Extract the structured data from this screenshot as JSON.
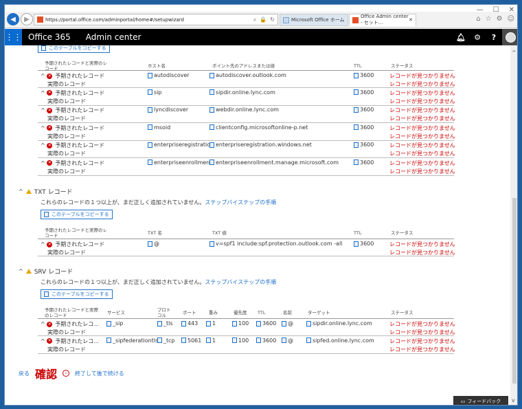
{
  "browser": {
    "url": "https://portal.office.com/adminportal/home#/setupwizard",
    "tabs": [
      {
        "label": "Microsoft Office ホーム"
      },
      {
        "label": "Office Admin center - セット..."
      }
    ]
  },
  "appbar": {
    "brand": "Office 365",
    "title": "Admin center",
    "icons": [
      "bell-icon",
      "gear-icon",
      "help-icon"
    ]
  },
  "copy_label": "このテーブルをコピーする",
  "expected_label": "予期されたレコード",
  "actual_label": "実際のレコード",
  "status_missing": "レコードが見つかりません",
  "cname": {
    "headers": {
      "record": "予期されたレコードと実際のレコード",
      "host": "ホスト名",
      "points": "ポイント先のアドレスまたは値",
      "ttl": "TTL",
      "status": "ステータス"
    },
    "rows": [
      {
        "host": "autodiscover",
        "value": "autodiscover.outlook.com",
        "ttl": "3600"
      },
      {
        "host": "sip",
        "value": "sipdir.online.lync.com",
        "ttl": "3600"
      },
      {
        "host": "lyncdiscover",
        "value": "webdir.online.lync.com",
        "ttl": "3600"
      },
      {
        "host": "msoid",
        "value": "clientconfig.microsoftonline-p.net",
        "ttl": "3600"
      },
      {
        "host": "enterpriseregistration",
        "value": "enterpriseregistration.windows.net",
        "ttl": "3600"
      },
      {
        "host": "enterpriseenrollment",
        "value": "enterpriseenrollment.manage.microsoft.com",
        "ttl": "3600"
      }
    ]
  },
  "txt": {
    "title": "TXT レコード",
    "desc": "これらのレコードの１つ以上が、まだ正しく追加されていません。",
    "link": "ステップバイステップの手順",
    "headers": {
      "record": "予期されたレコードと実際のレコード",
      "name": "TXT 名",
      "value": "TXT 値",
      "ttl": "TTL",
      "status": "ステータス"
    },
    "rows": [
      {
        "name": "@",
        "value": "v=spf1 include:spf.protection.outlook.com -all",
        "ttl": "3600"
      }
    ]
  },
  "srv": {
    "title": "SRV レコード",
    "desc": "これらのレコードの１つ以上が、まだ正しく追加されていません。",
    "link": "ステップバイステップの手順",
    "headers": {
      "record": "予期されたレコードと実際のレコード",
      "service": "サービス",
      "protocol": "プロトコル",
      "port": "ポート",
      "weight": "重み",
      "priority": "優先度",
      "ttl": "TTL",
      "name": "名前",
      "target": "ターゲット",
      "status": "ステータス"
    },
    "expected_short": "予期されたレコ...",
    "rows": [
      {
        "service": "_sip",
        "protocol": "_tls",
        "port": "443",
        "weight": "1",
        "priority": "100",
        "ttl": "3600",
        "name": "@",
        "target": "sipdir.online.lync.com"
      },
      {
        "service": "_sipfederationtls",
        "protocol": "_tcp",
        "port": "5061",
        "weight": "1",
        "priority": "100",
        "ttl": "3600",
        "name": "@",
        "target": "sipfed.online.lync.com"
      }
    ]
  },
  "footer": {
    "back": "戻る",
    "confirm": "確認",
    "later": "終了して後で続ける"
  },
  "feedback": "フィードバック"
}
